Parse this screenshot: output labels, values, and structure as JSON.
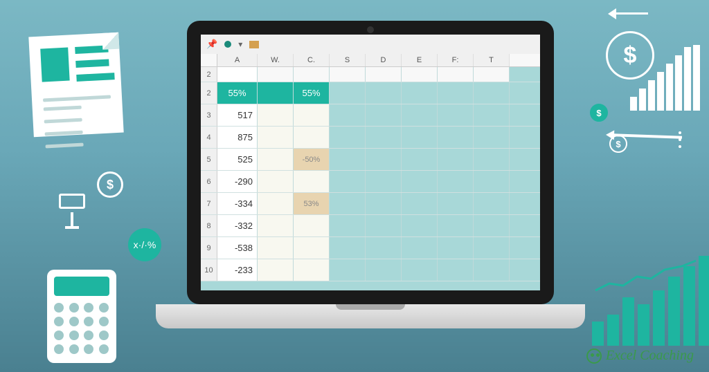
{
  "columns": [
    "A",
    "W.",
    "C.",
    "S",
    "D",
    "E",
    "F:",
    "T"
  ],
  "rows": [
    {
      "num": "2",
      "A": "",
      "W": "",
      "C": ""
    },
    {
      "num": "2",
      "A": "55%",
      "W": "",
      "C": "55%",
      "highlight": "teal"
    },
    {
      "num": "3",
      "A": "517",
      "W": "",
      "C": ""
    },
    {
      "num": "4",
      "A": "875",
      "W": "",
      "C": ""
    },
    {
      "num": "5",
      "A": "525",
      "W": "",
      "C": "-50%",
      "chighlight": "tan"
    },
    {
      "num": "6",
      "A": "-290",
      "W": "",
      "C": ""
    },
    {
      "num": "7",
      "A": "-334",
      "W": "",
      "C": "53%",
      "chighlight": "tan"
    },
    {
      "num": "8",
      "A": "-332",
      "W": "",
      "C": ""
    },
    {
      "num": "9",
      "A": "-538",
      "W": "",
      "C": ""
    },
    {
      "num": "10",
      "A": "-233",
      "W": "",
      "C": ""
    }
  ],
  "logo_text": "Excel Coaching",
  "percent_bubble": "x·/·%",
  "dollar_sign": "$",
  "chart_data": {
    "type": "bar",
    "white_bars": [
      20,
      32,
      44,
      56,
      68,
      80,
      92,
      95
    ],
    "green_bars": [
      35,
      45,
      70,
      60,
      80,
      100,
      115,
      130
    ]
  }
}
